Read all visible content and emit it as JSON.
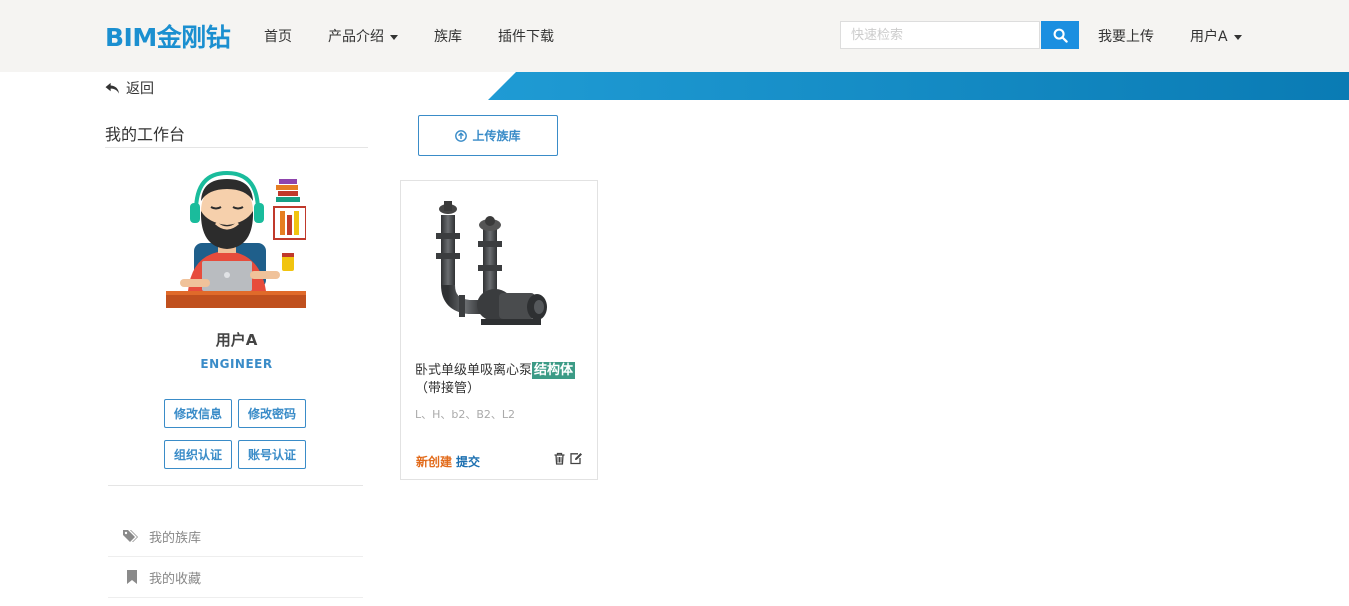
{
  "header": {
    "logo": "BIM金刚钻",
    "nav": {
      "home": "首页",
      "products": "产品介绍",
      "families": "族库",
      "plugins": "插件下载"
    },
    "search_placeholder": "快速检索",
    "upload": "我要上传",
    "user": "用户A"
  },
  "back_label": "返回",
  "sidebar": {
    "title": "我的工作台",
    "username": "用户A",
    "role": "ENGINEER",
    "buttons": {
      "edit_info": "修改信息",
      "change_password": "修改密码",
      "org_verify": "组织认证",
      "account_verify": "账号认证"
    },
    "menu": [
      {
        "label": "我的族库",
        "icon": "tags-icon"
      },
      {
        "label": "我的收藏",
        "icon": "bookmark-icon"
      }
    ]
  },
  "main": {
    "upload_button": "上传族库",
    "cards": [
      {
        "title": "卧式单级单吸离心泵",
        "tag": "结构体",
        "subtitle": "（带接管）",
        "params": "L、H、b2、B2、L2",
        "status": "新创建",
        "action": "提交"
      }
    ]
  },
  "colors": {
    "brand": "#1b8fd0",
    "accent": "#3a8cc8",
    "tag": "#3c9b86",
    "status_new": "#e26b1b"
  }
}
